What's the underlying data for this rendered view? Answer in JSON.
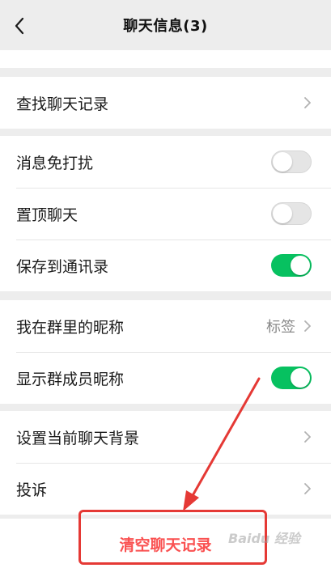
{
  "header": {
    "title": "聊天信息(3)"
  },
  "search_group": {
    "find_history_label": "查找聊天记录"
  },
  "toggle_group": {
    "items": [
      {
        "label": "消息免打扰",
        "state": "off"
      },
      {
        "label": "置顶聊天",
        "state": "off"
      },
      {
        "label": "保存到通讯录",
        "state": "on"
      }
    ]
  },
  "nickname_group": {
    "my_nickname_label": "我在群里的昵称",
    "my_nickname_value": "标签",
    "show_nicknames_label": "显示群成员昵称",
    "show_nicknames_state": "on"
  },
  "background_group": {
    "set_background_label": "设置当前聊天背景",
    "complain_label": "投诉"
  },
  "clear_history": {
    "label": "清空聊天记录"
  },
  "annotation": {
    "arrow_color": "#e53935",
    "box_color": "#e53935"
  },
  "colors": {
    "toggle_on": "#07c160",
    "danger": "#fa5151"
  },
  "watermark": {
    "text": "Baidu 经验"
  }
}
